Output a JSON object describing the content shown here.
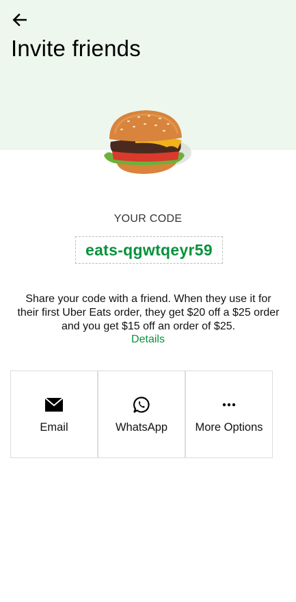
{
  "header": {
    "back_icon": "arrow-left-icon",
    "title": "Invite friends",
    "background_color": "#edf7ee"
  },
  "hero": {
    "image": "burger-illustration"
  },
  "code": {
    "label": "YOUR CODE",
    "value": "eats-qgwtqeyr59",
    "color": "#08913d"
  },
  "description": {
    "text": "Share your code with a friend. When they use it for their first Uber Eats order, they get $20 off a $25 order and you get $15 off an order of $25.",
    "details_link": "Details"
  },
  "share_options": [
    {
      "label": "Email",
      "icon": "envelope-icon"
    },
    {
      "label": "WhatsApp",
      "icon": "whatsapp-icon"
    },
    {
      "label": "More Options",
      "icon": "more-dots-icon"
    }
  ]
}
